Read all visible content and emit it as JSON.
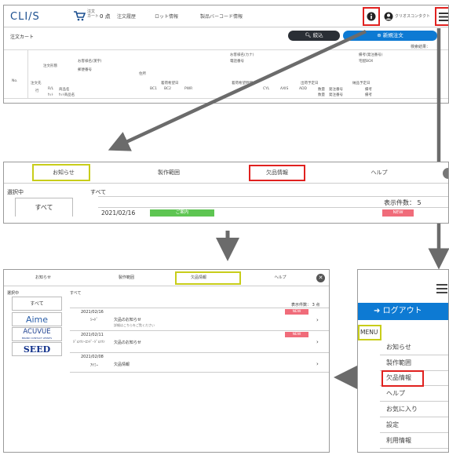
{
  "panel1": {
    "logo": "CLI/S",
    "cart_label": "注文\nカート",
    "cart_count": "0 点",
    "nav": [
      "注文履歴",
      "ロット情報",
      "製品バーコード情報"
    ],
    "user_label": "クリオスコンタクト",
    "page_title": "注文カート",
    "filter_button": "絞込",
    "new_order_button": "新規注文",
    "search_result_label": "検索結果：",
    "headers": {
      "furigana": "お客様名(カナ)",
      "note": "備考(発注番号)",
      "customer_kanji": "お客様名(漢字)",
      "phone": "電話番号",
      "delivery_box": "宅配BOX",
      "customer_no": "注文形態",
      "zip": "郵便番号",
      "address": "住所",
      "no": "No.",
      "dest": "注文先",
      "wish_date": "着荷希望日",
      "wish_time": "着荷希望時間",
      "ship_date": "出荷予定日",
      "deliv_date": "納品予定日",
      "row": "行",
      "rl": "R/L",
      "product": "商品名",
      "bc1": "BC1",
      "bc2": "BC2",
      "pwr": "PWR",
      "cyl": "CYL",
      "axis": "AXIS",
      "add": "ADD",
      "qty": "数量",
      "order_no": "発注番号",
      "remark": "備考",
      "set": "ｾｯﾄ",
      "set_product": "ｾｯﾄ商品名",
      "qty2": "数量",
      "order_no2": "発注番号",
      "remark2": "備考"
    }
  },
  "panel2": {
    "tabs": [
      "お知らせ",
      "製作範囲",
      "欠品情報",
      "ヘルプ"
    ],
    "selected_label": "選択中",
    "all_label": "すべて",
    "filter_all": "すべて",
    "count_label": "表示件数：",
    "count": "5",
    "row_date": "2021/02/16",
    "row_badge": "ご案内",
    "row_new": "NEW"
  },
  "panel3": {
    "tabs": [
      "お知らせ",
      "製作範囲",
      "欠品情報",
      "ヘルプ"
    ],
    "selected_label": "選択中",
    "all_label": "すべて",
    "filter_all": "すべて",
    "count_label": "表示件数：",
    "count": "3",
    "count_unit": "点",
    "brands": [
      "Aime",
      "ACUVUE",
      "SEED"
    ],
    "acuvue_sub": "BRAND CONTACT LENSES",
    "rows": [
      {
        "date": "2021/02/16",
        "maker": "ｼｰﾄﾞ",
        "title": "欠品のお知らせ",
        "sub": "詳細はこちらをご覧ください",
        "new": "NEW"
      },
      {
        "date": "2021/02/11",
        "maker": "ｼﾞｮﾝｿﾝ･ｴﾝﾄﾞ･ｼﾞｮﾝｿﾝ",
        "title": "欠品のお知らせ",
        "sub": "",
        "new": "NEW"
      },
      {
        "date": "2021/02/08",
        "maker": "ｱｲﾐｰ",
        "title": "欠品情報",
        "sub": "",
        "new": ""
      }
    ]
  },
  "panel4": {
    "logout": "ログアウト",
    "menu_label": "MENU",
    "items": [
      "お知らせ",
      "製作範囲",
      "欠品情報",
      "ヘルプ",
      "お気に入り",
      "設定",
      "利用情報"
    ]
  },
  "colors": {
    "highlight_red": "#e0211f",
    "highlight_yellow": "#c8cd1a",
    "primary_blue": "#0d7ad3",
    "badge_green": "#5ec552",
    "badge_pink": "#f06c7a"
  }
}
